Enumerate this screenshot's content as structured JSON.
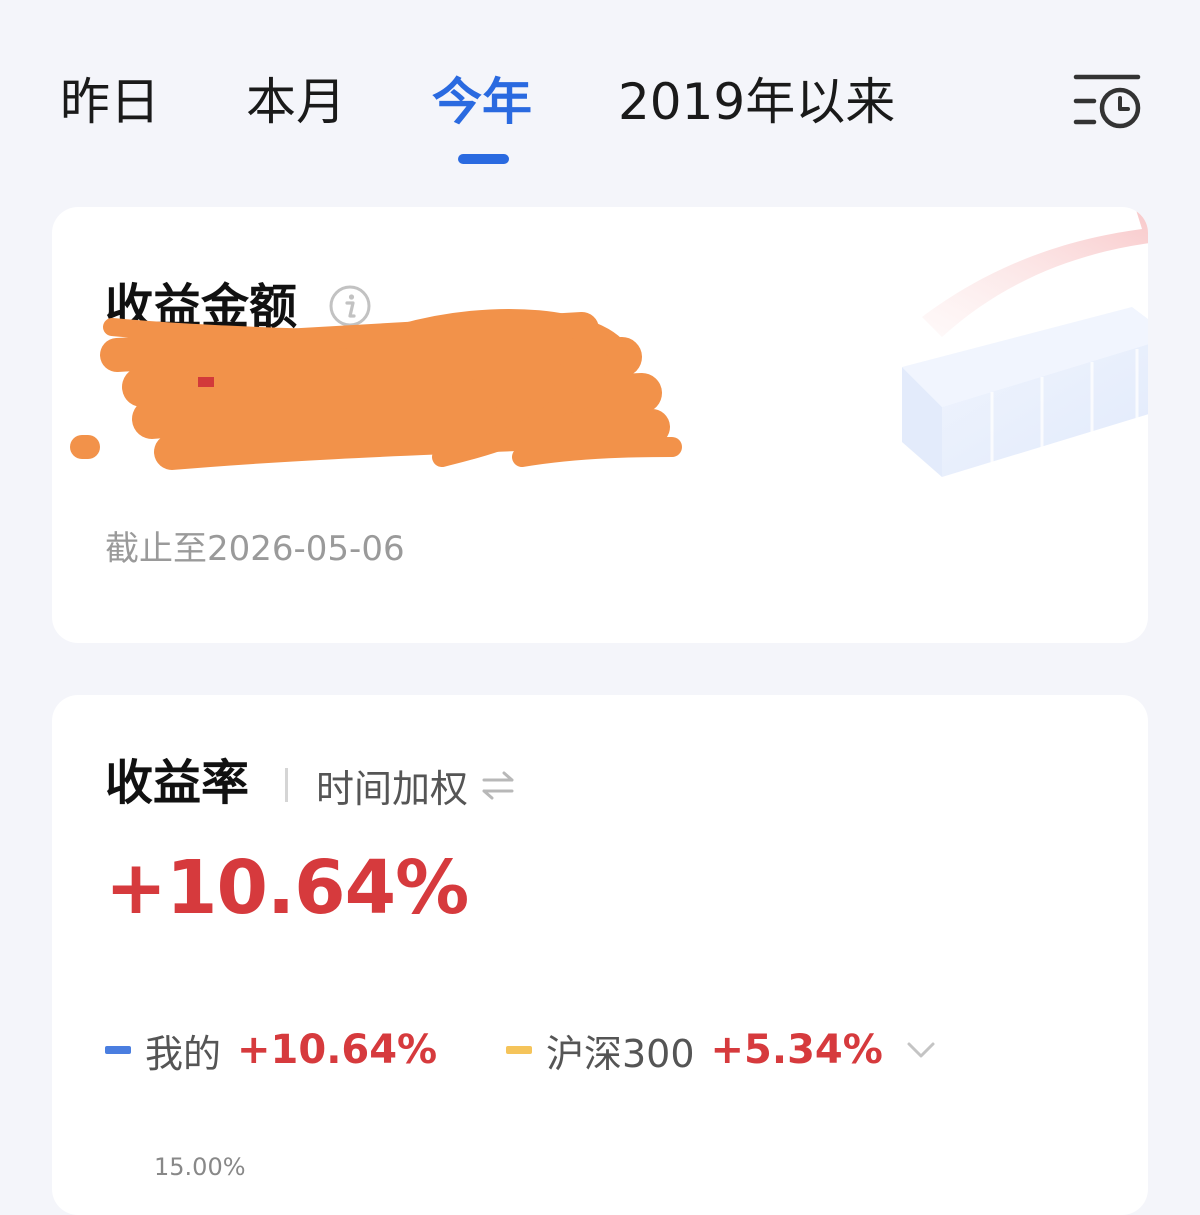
{
  "tabs": [
    {
      "label": "昨日"
    },
    {
      "label": "本月"
    },
    {
      "label": "今年",
      "active": true
    },
    {
      "label": "2019年以来"
    }
  ],
  "header": {
    "history_icon": "list-clock-icon"
  },
  "amount_card": {
    "title": "收益金额",
    "info_icon": "info-icon",
    "as_of": "截止至2026-05-06"
  },
  "rate_card": {
    "title": "收益率",
    "method_label": "时间加权",
    "method_icon": "swap-icon",
    "value": "+10.64%",
    "legend": [
      {
        "label": "我的",
        "value": "+10.64%",
        "color": "#4a7ee0"
      },
      {
        "label": "沪深300",
        "value": "+5.34%",
        "color": "#f5c45a"
      }
    ],
    "axis_top_label": "15.00%"
  },
  "colors": {
    "accent": "#2a6ae0",
    "gain": "#d63a3d",
    "background": "#f4f5fa",
    "card": "#ffffff",
    "muted_text": "#9a9a9a"
  }
}
